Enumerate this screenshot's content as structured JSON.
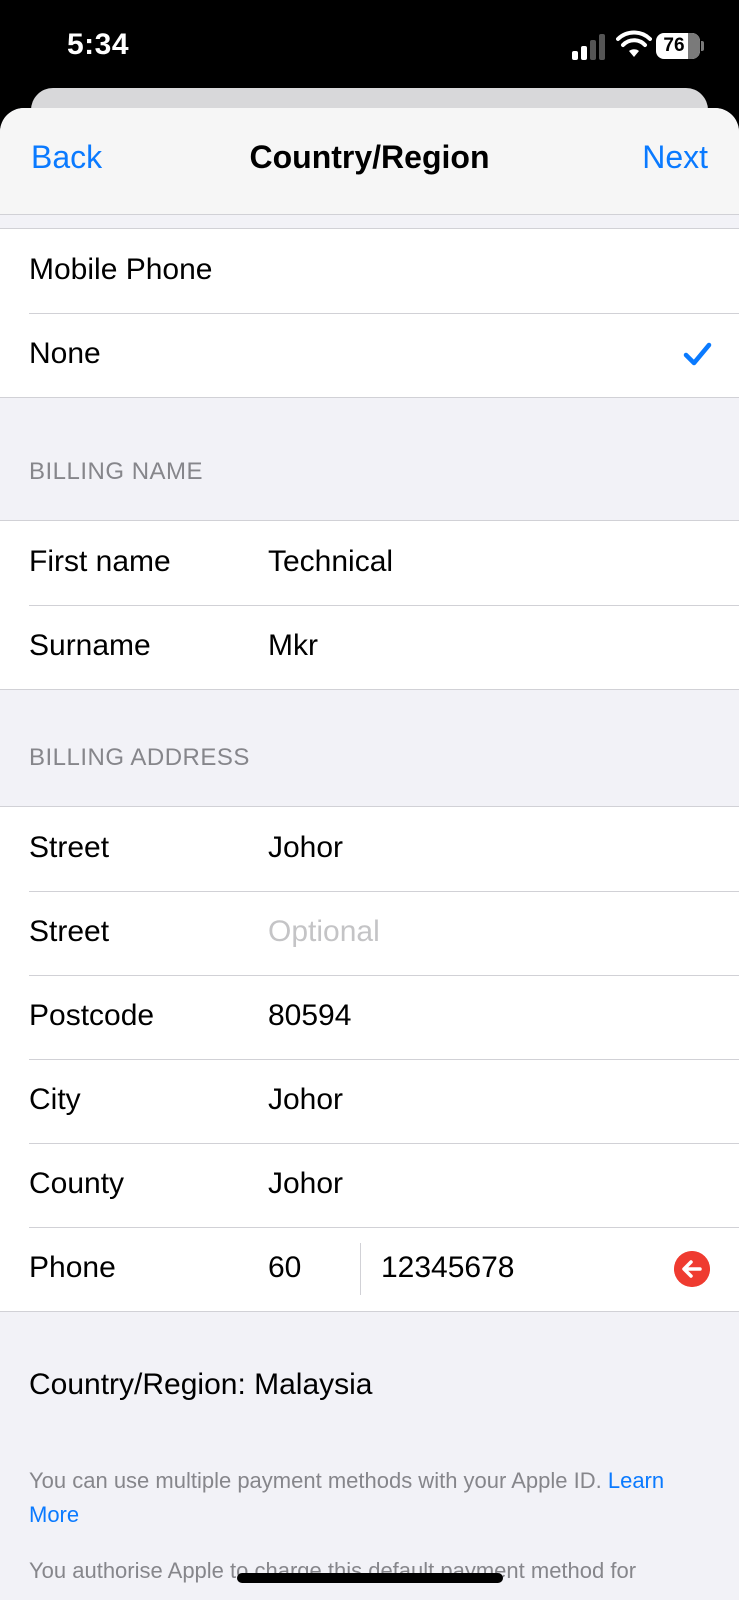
{
  "status_bar": {
    "time": "5:34",
    "battery": "76"
  },
  "nav": {
    "back": "Back",
    "title": "Country/Region",
    "next": "Next"
  },
  "payment_options": {
    "items": [
      {
        "label": "Mobile Phone",
        "selected": false
      },
      {
        "label": "None",
        "selected": true
      }
    ]
  },
  "billing_name": {
    "header": "BILLING NAME",
    "first_name": {
      "label": "First name",
      "value": "Technical"
    },
    "surname": {
      "label": "Surname",
      "value": "Mkr"
    }
  },
  "billing_address": {
    "header": "BILLING ADDRESS",
    "street1": {
      "label": "Street",
      "value": "Johor"
    },
    "street2": {
      "label": "Street",
      "placeholder": "Optional"
    },
    "postcode": {
      "label": "Postcode",
      "value": "80594"
    },
    "city": {
      "label": "City",
      "value": "Johor"
    },
    "county": {
      "label": "County",
      "value": "Johor"
    },
    "phone": {
      "label": "Phone",
      "country_code": "60",
      "number": "12345678"
    }
  },
  "country_region": "Country/Region: Malaysia",
  "footer": {
    "note1_text": "You can use multiple payment methods with your Apple ID. ",
    "note1_link": "Learn More",
    "note2_text": "You authorise Apple to charge this default payment method for"
  },
  "colors": {
    "accent": "#0a7aff",
    "destructive": "#ef3b30",
    "background": "#f2f2f7"
  }
}
